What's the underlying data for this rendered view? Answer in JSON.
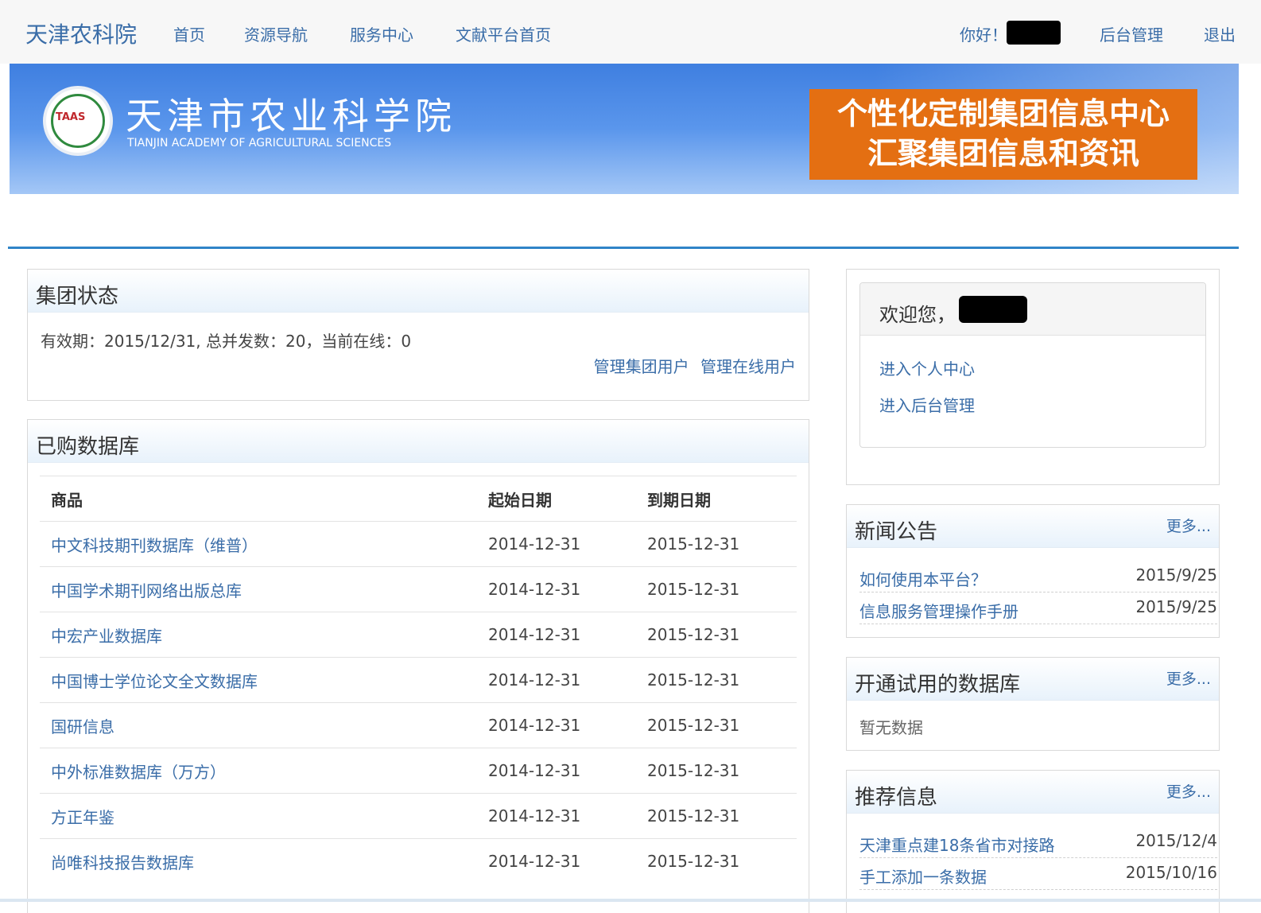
{
  "topnav": {
    "brand": "天津农科院",
    "links": [
      "首页",
      "资源导航",
      "服务中心",
      "文献平台首页"
    ],
    "greeting": "你好！",
    "admin": "后台管理",
    "logout": "退出"
  },
  "banner": {
    "logo_text": "TAAS",
    "name_cn": "天津市农业科学院",
    "name_en": "TIANJIN ACADEMY OF AGRICULTURAL SCIENCES",
    "promo_line1": "个性化定制集团信息中心",
    "promo_line2": "汇聚集团信息和资讯"
  },
  "group_status": {
    "title": "集团状态",
    "info": "有效期：2015/12/31, 总并发数：20，当前在线：0",
    "link_manage_users": "管理集团用户",
    "link_manage_online": "管理在线用户"
  },
  "databases": {
    "title": "已购数据库",
    "headers": [
      "商品",
      "起始日期",
      "到期日期"
    ],
    "rows": [
      {
        "name": "中文科技期刊数据库（维普）",
        "start": "2014-12-31",
        "end": "2015-12-31"
      },
      {
        "name": "中国学术期刊网络出版总库",
        "start": "2014-12-31",
        "end": "2015-12-31"
      },
      {
        "name": "中宏产业数据库",
        "start": "2014-12-31",
        "end": "2015-12-31"
      },
      {
        "name": "中国博士学位论文全文数据库",
        "start": "2014-12-31",
        "end": "2015-12-31"
      },
      {
        "name": "国研信息",
        "start": "2014-12-31",
        "end": "2015-12-31"
      },
      {
        "name": "中外标准数据库（万方）",
        "start": "2014-12-31",
        "end": "2015-12-31"
      },
      {
        "name": "方正年鉴",
        "start": "2014-12-31",
        "end": "2015-12-31"
      },
      {
        "name": "尚唯科技报告数据库",
        "start": "2014-12-31",
        "end": "2015-12-31"
      }
    ]
  },
  "welcome": {
    "title": "欢迎您，",
    "link_personal": "进入个人中心",
    "link_admin": "进入后台管理"
  },
  "news": {
    "title": "新闻公告",
    "more": "更多...",
    "items": [
      {
        "title": "如何使用本平台？",
        "date": "2015/9/25"
      },
      {
        "title": "信息服务管理操作手册",
        "date": "2015/9/25"
      }
    ]
  },
  "trial": {
    "title": "开通试用的数据库",
    "more": "更多...",
    "empty": "暂无数据"
  },
  "recommend": {
    "title": "推荐信息",
    "more": "更多...",
    "items": [
      {
        "title": "天津重点建18条省市对接路",
        "date": "2015/12/4"
      },
      {
        "title": "手工添加一条数据",
        "date": "2015/10/16"
      }
    ]
  }
}
